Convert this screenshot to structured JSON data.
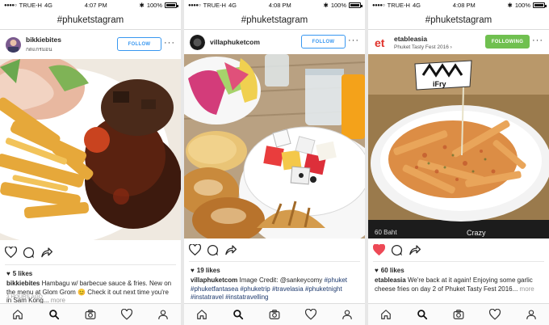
{
  "status": {
    "carrier": "TRUE-H",
    "network": "4G",
    "battery": "100%"
  },
  "screens": [
    {
      "time": "4:07 PM",
      "title": "#phuketstagram",
      "username": "bikkiebites",
      "location": "กดแกรมอน",
      "follow_label": "FOLLOW",
      "likes": "5 likes",
      "caption_user": "bikkiebites",
      "caption_text": "Hambagu w/ barbecue sauce & fries. New on the menu at Glom Grom 😊 Check it out next time you're in Sam Kong...",
      "more_label": "more",
      "footer": "3 HOURS AGO"
    },
    {
      "time": "4:08 PM",
      "title": "#phuketstagram",
      "username": "villaphuketcom",
      "location": "",
      "follow_label": "FOLLOW",
      "likes": "19 likes",
      "caption_user": "villaphuketcom",
      "caption_text": "Image Credit: @sankeycomy",
      "caption_tags": "#phuket #phuketfantasea #phuketrip #travelasia #phuketnight #instatravel #instatravelling",
      "more_label": "",
      "footer": ""
    },
    {
      "time": "4:08 PM",
      "title": "#phuketstagram",
      "username": "etableasia",
      "location": "Phuket Tasty Fest 2016",
      "follow_label": "FOLLOWING",
      "likes": "60 likes",
      "caption_user": "etableasia",
      "caption_text": "We're back at it again! Enjoying some garlic cheese fries on day 2 of Phuket Tasty Fest 2016...",
      "more_label": "more",
      "footer": "",
      "photo_sign": "iFry",
      "photo_strip": "Crazy",
      "photo_strip_price": "60 Baht"
    }
  ],
  "colors": {
    "follow_blue": "#3897f0",
    "following_green": "#70c050",
    "like_red": "#ed4956"
  }
}
